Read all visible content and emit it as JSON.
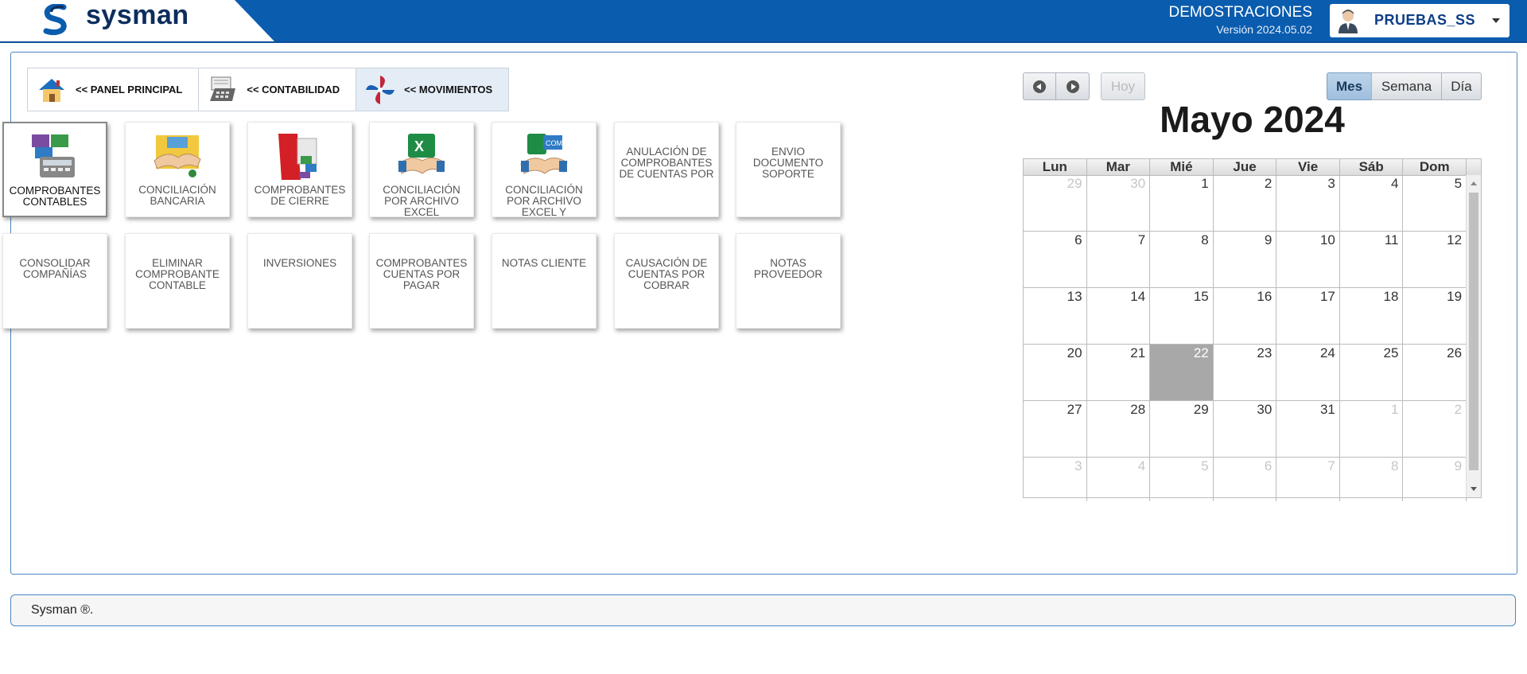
{
  "brand": {
    "name": "sysman"
  },
  "org": {
    "name": "DEMOSTRACIONES",
    "version": "Versión 2024.05.02"
  },
  "user": {
    "name": "PRUEBAS_SS"
  },
  "breadcrumbs": [
    {
      "label": "<< PANEL PRINCIPAL",
      "icon": "house-icon"
    },
    {
      "label": "<< CONTABILIDAD",
      "icon": "calculator-icon"
    },
    {
      "label": "<< MOVIMIENTOS",
      "icon": "pinwheel-icon"
    }
  ],
  "tiles": [
    {
      "label": "COMPROBANTES CONTABLES",
      "icon": "documents-calculator-icon"
    },
    {
      "label": "CONCILIACIÓN BANCARIA",
      "icon": "handshake-icon"
    },
    {
      "label": "COMPROBANTES DE CIERRE",
      "icon": "documents-close-icon"
    },
    {
      "label": "CONCILIACIÓN POR ARCHIVO EXCEL",
      "icon": "excel-handshake-icon"
    },
    {
      "label": "CONCILIACIÓN POR ARCHIVO EXCEL Y",
      "icon": "excel-com-handshake-icon"
    },
    {
      "label": "ANULACIÓN DE COMPROBANTES DE CUENTAS POR"
    },
    {
      "label": "ENVIO DOCUMENTO SOPORTE"
    },
    {
      "label": "CONSOLIDAR COMPAÑÍAS"
    },
    {
      "label": "ELIMINAR COMPROBANTE CONTABLE"
    },
    {
      "label": "INVERSIONES"
    },
    {
      "label": "COMPROBANTES CUENTAS POR PAGAR"
    },
    {
      "label": "NOTAS CLIENTE"
    },
    {
      "label": "CAUSACIÓN DE CUENTAS POR COBRAR"
    },
    {
      "label": "NOTAS PROVEEDOR"
    }
  ],
  "calendar": {
    "today_label": "Hoy",
    "views": [
      "Mes",
      "Semana",
      "Día"
    ],
    "active_view": "Mes",
    "title": "Mayo 2024",
    "weekdays": [
      "Lun",
      "Mar",
      "Mié",
      "Jue",
      "Vie",
      "Sáb",
      "Dom"
    ],
    "weeks": [
      [
        {
          "d": "29",
          "o": true
        },
        {
          "d": "30",
          "o": true
        },
        {
          "d": "1"
        },
        {
          "d": "2"
        },
        {
          "d": "3"
        },
        {
          "d": "4"
        },
        {
          "d": "5"
        }
      ],
      [
        {
          "d": "6"
        },
        {
          "d": "7"
        },
        {
          "d": "8"
        },
        {
          "d": "9"
        },
        {
          "d": "10"
        },
        {
          "d": "11"
        },
        {
          "d": "12"
        }
      ],
      [
        {
          "d": "13"
        },
        {
          "d": "14"
        },
        {
          "d": "15"
        },
        {
          "d": "16"
        },
        {
          "d": "17"
        },
        {
          "d": "18"
        },
        {
          "d": "19"
        }
      ],
      [
        {
          "d": "20"
        },
        {
          "d": "21"
        },
        {
          "d": "22",
          "t": true
        },
        {
          "d": "23"
        },
        {
          "d": "24"
        },
        {
          "d": "25"
        },
        {
          "d": "26"
        }
      ],
      [
        {
          "d": "27"
        },
        {
          "d": "28"
        },
        {
          "d": "29"
        },
        {
          "d": "30"
        },
        {
          "d": "31"
        },
        {
          "d": "1",
          "o": true
        },
        {
          "d": "2",
          "o": true
        }
      ],
      [
        {
          "d": "3",
          "o": true
        },
        {
          "d": "4",
          "o": true
        },
        {
          "d": "5",
          "o": true
        },
        {
          "d": "6",
          "o": true
        },
        {
          "d": "7",
          "o": true
        },
        {
          "d": "8",
          "o": true
        },
        {
          "d": "9",
          "o": true
        }
      ]
    ]
  },
  "footer": {
    "text": "Sysman ®."
  }
}
